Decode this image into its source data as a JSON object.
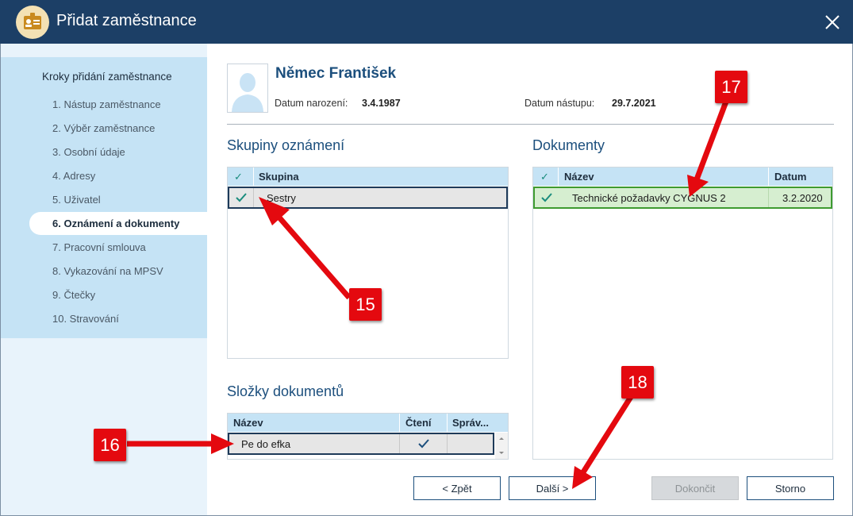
{
  "window": {
    "title": "Přidat zaměstnance"
  },
  "sidebar": {
    "heading": "Kroky přidání zaměstnance",
    "steps": [
      "1. Nástup zaměstnance",
      "2. Výběr zaměstnance",
      "3. Osobní údaje",
      "4. Adresy",
      "5. Uživatel",
      "6. Oznámení a dokumenty",
      "7. Pracovní smlouva",
      "8. Vykazování na MPSV",
      "9. Čtečky",
      "10. Stravování"
    ],
    "active_index": 5
  },
  "employee": {
    "name": "Němec František",
    "birth_label": "Datum narození:",
    "birth_value": "3.4.1987",
    "start_label": "Datum nástupu:",
    "start_value": "29.7.2021"
  },
  "groups": {
    "title": "Skupiny oznámení",
    "col_check": "✓",
    "col_name": "Skupina",
    "rows": [
      {
        "checked": true,
        "name": "Sestry"
      }
    ]
  },
  "folders": {
    "title": "Složky dokumentů",
    "col_name": "Název",
    "col_read": "Čtení",
    "col_admin": "Správ...",
    "rows": [
      {
        "name": "Pe do efka",
        "read": true,
        "admin": false
      }
    ]
  },
  "documents": {
    "title": "Dokumenty",
    "col_check": "✓",
    "col_name": "Název",
    "col_date": "Datum",
    "rows": [
      {
        "checked": true,
        "name": "Technické požadavky CYGNUS 2",
        "date": "3.2.2020"
      }
    ]
  },
  "buttons": {
    "back": "< Zpět",
    "next": "Další >",
    "finish": "Dokončit",
    "cancel": "Storno"
  },
  "annotations": [
    "15",
    "16",
    "17",
    "18"
  ],
  "colors": {
    "titlebar": "#1c3f66",
    "sidebar": "#c5e3f5",
    "accent_text": "#1c4f7d",
    "check": "#1a8c7d",
    "selected_green": "#d6eed0",
    "annotation_red": "#e4090f"
  }
}
